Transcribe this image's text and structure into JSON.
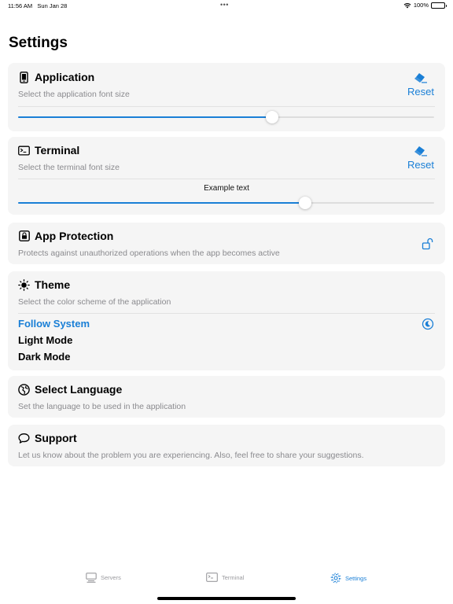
{
  "status_bar": {
    "time": "11:56 AM",
    "date": "Sun Jan 28",
    "dots": "•••",
    "battery": "100%"
  },
  "page_title": "Settings",
  "application": {
    "title": "Application",
    "subtitle": "Select the application font size",
    "reset_label": "Reset",
    "slider_value": 0.61
  },
  "terminal": {
    "title": "Terminal",
    "subtitle": "Select the terminal font size",
    "reset_label": "Reset",
    "example_text": "Example text",
    "slider_value": 0.69
  },
  "app_protection": {
    "title": "App Protection",
    "subtitle": "Protects against unauthorized operations when the app becomes active"
  },
  "theme": {
    "title": "Theme",
    "subtitle": "Select the color scheme of the application",
    "options": [
      "Follow System",
      "Light Mode",
      "Dark Mode"
    ],
    "selected": "Follow System"
  },
  "language": {
    "title": "Select Language",
    "subtitle": "Set the language to be used in the application"
  },
  "support": {
    "title": "Support",
    "subtitle": "Let us know about the problem you are experiencing. Also, feel free to share your suggestions."
  },
  "tabs": [
    {
      "label": "Servers",
      "icon": "server-icon",
      "active": false
    },
    {
      "label": "Terminal",
      "icon": "terminal-icon",
      "active": false
    },
    {
      "label": "Settings",
      "icon": "gear-icon",
      "active": true
    }
  ],
  "colors": {
    "accent": "#1a7fd6",
    "card": "#f5f5f5",
    "secondary_text": "#8a8a8e"
  }
}
